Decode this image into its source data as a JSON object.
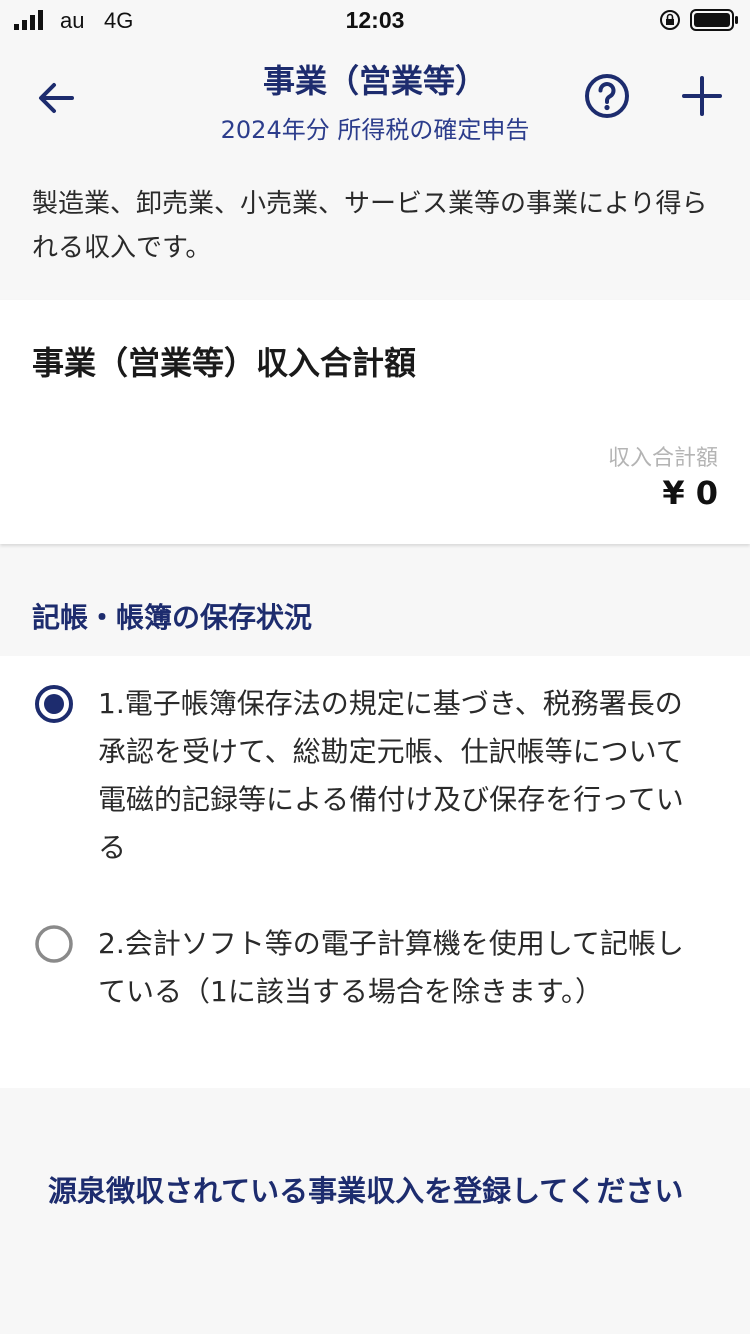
{
  "status_bar": {
    "carrier": "au",
    "network": "4G",
    "time": "12:03"
  },
  "header": {
    "title": "事業（営業等）",
    "subtitle": "2024年分 所得税の確定申告"
  },
  "description": "製造業、卸売業、小売業、サービス業等の事業により得られる収入です。",
  "income_card": {
    "title": "事業（営業等）収入合計額",
    "label": "収入合計額",
    "amount": "¥ 0"
  },
  "bookkeeping": {
    "title": "記帳・帳簿の保存状況",
    "options": [
      {
        "label": "1.電子帳簿保存法の規定に基づき、税務署長の承認を受けて、総勘定元帳、仕訳帳等について電磁的記録等による備付け及び保存を行っている",
        "selected": true
      },
      {
        "label": "2.会計ソフト等の電子計算機を使用して記帳している（1に該当する場合を除きます。）",
        "selected": false
      }
    ]
  },
  "withholding_link": "源泉徴収されている事業収入を登録してください",
  "colors": {
    "accent": "#1d2c6e",
    "radio_unselected": "#8a8a8a",
    "background": "#f7f7f7"
  },
  "icons": [
    "back-arrow-icon",
    "help-icon",
    "plus-icon",
    "signal-icon",
    "rotation-lock-icon",
    "battery-icon"
  ]
}
